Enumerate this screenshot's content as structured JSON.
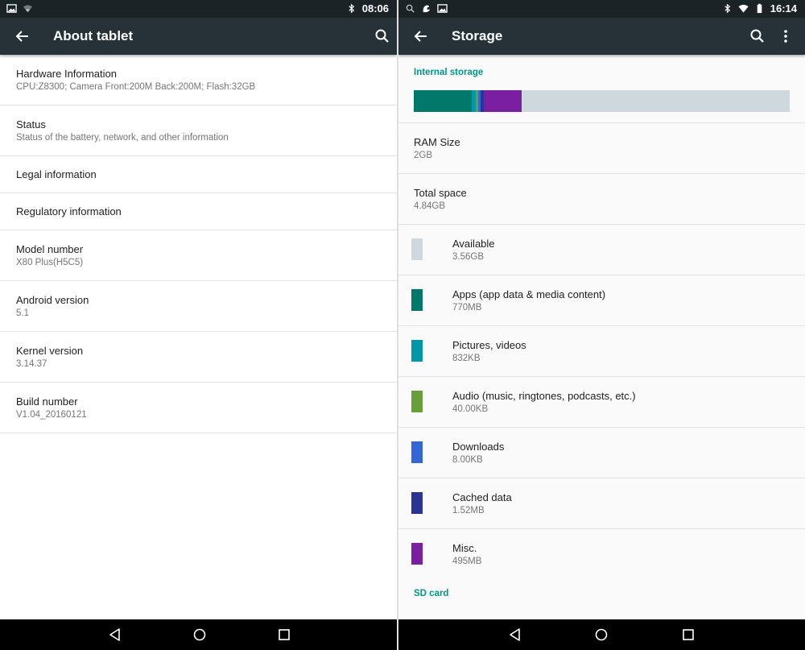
{
  "left": {
    "status": {
      "time": "08:06",
      "icons_left": [
        "image-icon",
        "wifi-signal-icon"
      ],
      "icons_right": [
        "bluetooth-icon"
      ]
    },
    "appbar": {
      "title": "About tablet"
    },
    "items": [
      {
        "title": "Hardware Information",
        "subtitle": "CPU:Z8300; Camera Front:200M Back:200M; Flash:32GB"
      },
      {
        "title": "Status",
        "subtitle": "Status of the battery, network, and other information"
      },
      {
        "title": "Legal information"
      },
      {
        "title": "Regulatory information"
      },
      {
        "title": "Model number",
        "subtitle": "X80 Plus(H5C5)"
      },
      {
        "title": "Android version",
        "subtitle": "5.1"
      },
      {
        "title": "Kernel version",
        "subtitle": "3.14.37"
      },
      {
        "title": "Build number",
        "subtitle": "V1.04_20160121"
      }
    ]
  },
  "right": {
    "status": {
      "time": "16:14",
      "icons_left": [
        "search-icon",
        "app-icon",
        "image-icon"
      ],
      "icons_right": [
        "bluetooth-icon",
        "wifi-icon",
        "battery-icon"
      ]
    },
    "appbar": {
      "title": "Storage"
    },
    "internal_label": "Internal storage",
    "storage_bar_segments": [
      {
        "label": "Apps",
        "fraction": 0.155,
        "color": "#00796b"
      },
      {
        "label": "Pictures",
        "fraction": 0.009,
        "color": "#0097a7"
      },
      {
        "label": "Audio",
        "fraction": 0.008,
        "color": "#689f38"
      },
      {
        "label": "Downloads",
        "fraction": 0.006,
        "color": "#3367d6"
      },
      {
        "label": "Cached",
        "fraction": 0.009,
        "color": "#283593"
      },
      {
        "label": "Misc",
        "fraction": 0.1,
        "color": "#7b1fa2"
      }
    ],
    "info": [
      {
        "title": "RAM Size",
        "value": "2GB"
      },
      {
        "title": "Total space",
        "value": "4.84GB"
      }
    ],
    "categories": [
      {
        "title": "Available",
        "value": "3.56GB",
        "color": "#cfd8dc"
      },
      {
        "title": "Apps (app data & media content)",
        "value": "770MB",
        "color": "#00796b"
      },
      {
        "title": "Pictures, videos",
        "value": "832KB",
        "color": "#0097a7"
      },
      {
        "title": "Audio (music, ringtones, podcasts, etc.)",
        "value": "40.00KB",
        "color": "#689f38"
      },
      {
        "title": "Downloads",
        "value": "8.00KB",
        "color": "#3367d6"
      },
      {
        "title": "Cached data",
        "value": "1.52MB",
        "color": "#283593"
      },
      {
        "title": "Misc.",
        "value": "495MB",
        "color": "#7b1fa2"
      }
    ],
    "sd_label": "SD card"
  },
  "navbar": {
    "buttons": [
      "back-icon",
      "home-icon",
      "recents-icon"
    ]
  },
  "colors": {
    "statusbar": "#1c2327",
    "appbar": "#263238",
    "accent": "#009688"
  }
}
